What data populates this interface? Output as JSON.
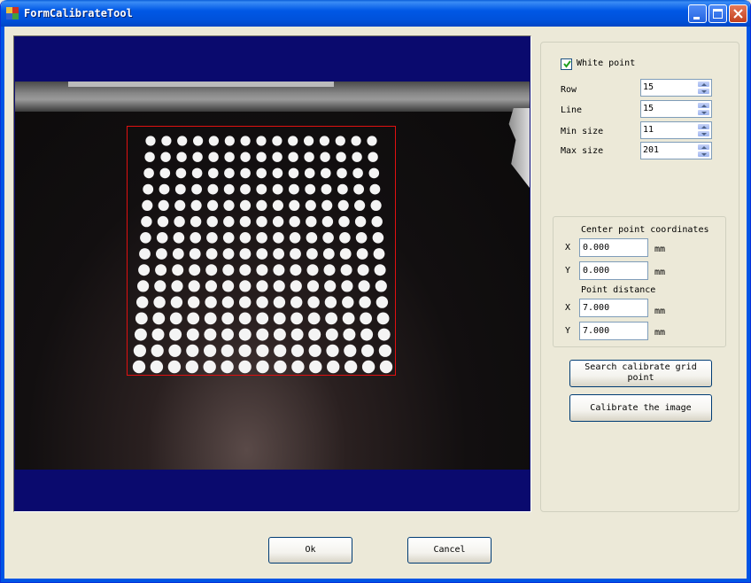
{
  "window": {
    "title": "FormCalibrateTool"
  },
  "image": {
    "grid_rows": 15,
    "grid_cols": 15
  },
  "settings": {
    "white_point_label": "White point",
    "white_point_checked": true,
    "row_label": "Row",
    "row_value": "15",
    "line_label": "Line",
    "line_value": "15",
    "min_size_label": "Min size",
    "min_size_value": "11",
    "max_size_label": "Max size",
    "max_size_value": "201"
  },
  "center": {
    "heading": "Center point coordinates",
    "x_label": "X",
    "x_value": "0.000",
    "x_unit": "mm",
    "y_label": "Y",
    "y_value": "0.000",
    "y_unit": "mm"
  },
  "distance": {
    "heading": "Point distance",
    "x_label": "X",
    "x_value": "7.000",
    "x_unit": "mm",
    "y_label": "Y",
    "y_value": "7.000",
    "y_unit": "mm"
  },
  "buttons": {
    "search_line1": "Search calibrate grid",
    "search_line2": "point",
    "calibrate": "Calibrate the image",
    "ok": "Ok",
    "cancel": "Cancel"
  },
  "colors": {
    "roi_border": "#e01010",
    "titlebar": "#0058e6",
    "image_bg": "#0a0a6e"
  }
}
